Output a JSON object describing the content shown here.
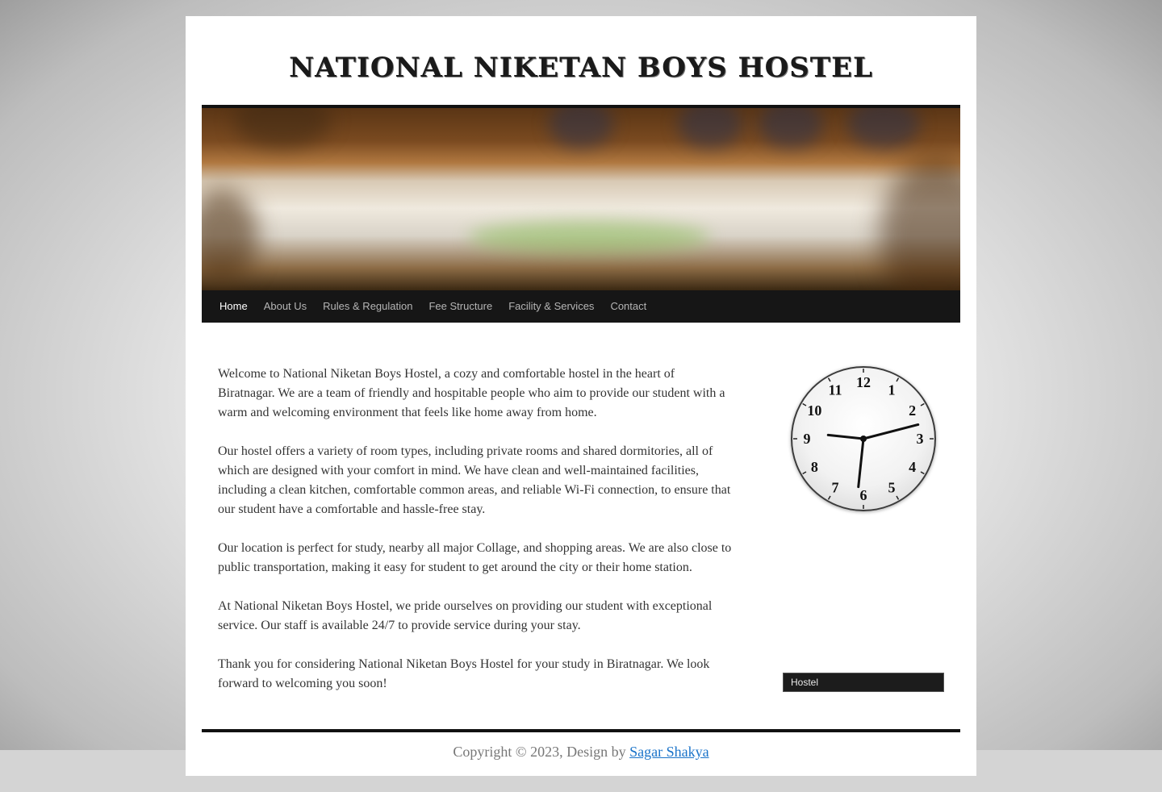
{
  "site": {
    "title": "NATIONAL NIKETAN BOYS HOSTEL"
  },
  "nav": {
    "items": [
      {
        "label": "Home",
        "active": true
      },
      {
        "label": "About Us"
      },
      {
        "label": "Rules & Regulation"
      },
      {
        "label": "Fee Structure"
      },
      {
        "label": "Facility & Services"
      },
      {
        "label": "Contact"
      }
    ]
  },
  "content": {
    "paragraphs": [
      "Welcome to National Niketan Boys Hostel, a cozy and comfortable hostel in the heart of Biratnagar. We are a team of friendly and hospitable people who aim to provide our student with a warm and welcoming environment that feels like home away from home.",
      "Our hostel offers a variety of room types, including private rooms and shared dormitories, all of which are designed with your comfort in mind. We have clean and well-maintained facilities, including a clean kitchen, comfortable common areas, and reliable Wi-Fi connection, to ensure that our student have a comfortable and hassle-free stay.",
      "Our location is perfect for study, nearby all major Collage, and shopping areas. We are also close to public transportation, making it easy for student to get around the city or their home station.",
      "At National Niketan Boys Hostel, we pride ourselves on providing our student with exceptional service. Our staff is available 24/7 to provide service during your stay.",
      "Thank you for considering National Niketan Boys Hostel for your study in Biratnagar. We look forward to welcoming you soon!"
    ]
  },
  "clock": {
    "numerals": [
      "12",
      "1",
      "2",
      "3",
      "4",
      "5",
      "6",
      "7",
      "8",
      "9",
      "10",
      "11"
    ],
    "time": {
      "hour": 2,
      "minute": 31,
      "second": 46
    }
  },
  "sidebar": {
    "widget_label": "Hostel"
  },
  "footer": {
    "copyright": "Copyright © 2023, Design by",
    "author": "Sagar Shakya"
  },
  "colors": {
    "nav_bg": "#161616",
    "link": "#1a73c9"
  }
}
